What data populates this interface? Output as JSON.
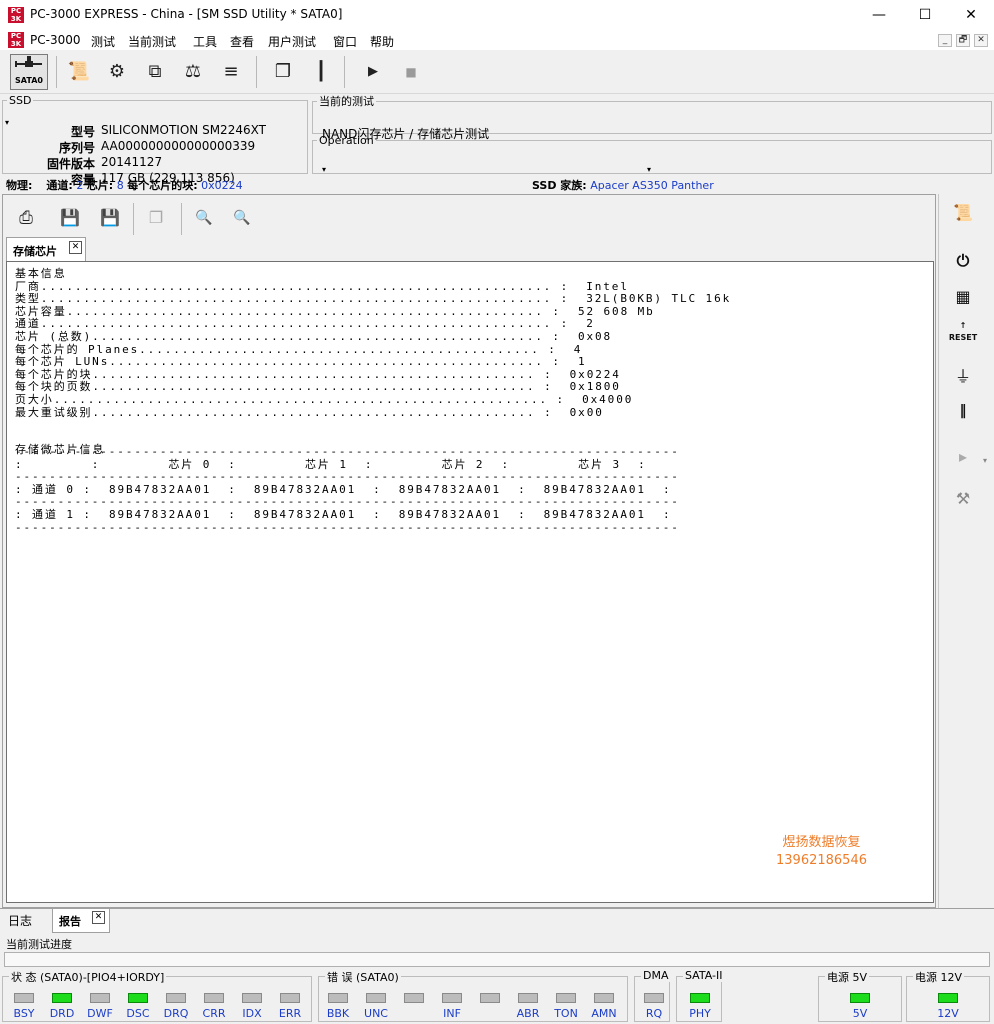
{
  "window": {
    "title": "PC-3000 EXPRESS - China - [SM SSD Utility * SATA0]",
    "controls": [
      "—",
      "☐",
      "✕"
    ]
  },
  "menu": {
    "items": [
      "PC-3000",
      "测试",
      "当前测试",
      "工具",
      "查看",
      "用户测试",
      "窗口",
      "帮助"
    ],
    "mdi": [
      "_",
      "🗗",
      "✕"
    ]
  },
  "toolbar": {
    "sata_label": "SATA0"
  },
  "ssd": {
    "legend": "SSD",
    "fields": [
      {
        "k": "型号",
        "v": "SILICONMOTION SM2246XT"
      },
      {
        "k": "序列号",
        "v": "AA000000000000000339"
      },
      {
        "k": "固件版本",
        "v": "20141127"
      },
      {
        "k": "容量",
        "v": "117 GB (229 113 856)"
      }
    ]
  },
  "current_test": {
    "legend": "当前的测试",
    "value": "NAND闪存芯片 / 存储芯片测试"
  },
  "operation": {
    "legend": "Operation",
    "value": ""
  },
  "phys": {
    "label": "物理:",
    "channels_label": "通道:",
    "channels": "2",
    "chips_label": "芯片:",
    "chips": "8",
    "blocks_label": "每个芯片的块:",
    "blocks": "0x0224",
    "family_label": "SSD 家族:",
    "family": "Apacer AS350 Panther"
  },
  "inner_tab": {
    "label": "存储芯片",
    "close": "✕"
  },
  "report": {
    "section1_title": "基本信息",
    "rows": [
      {
        "label": "厂商",
        "value": "Intel"
      },
      {
        "label": "类型",
        "value": "32L(B0KB) TLC 16k"
      },
      {
        "label": "芯片容量",
        "value": "52 608 Mb"
      },
      {
        "label": "通道",
        "value": "2"
      },
      {
        "label": "芯片 (总数)",
        "value": "0x08"
      },
      {
        "label": "每个芯片的 Planes",
        "value": "4"
      },
      {
        "label": "每个芯片 LUNs",
        "value": "1"
      },
      {
        "label": "每个芯片的块",
        "value": "0x0224"
      },
      {
        "label": "每个块的页数",
        "value": "0x1800"
      },
      {
        "label": "页大小",
        "value": "0x4000"
      },
      {
        "label": "最大重试级别",
        "value": "0x00"
      }
    ],
    "section2_title": "存储微芯片信息",
    "table": {
      "headers": [
        "芯片 0",
        "芯片 1",
        "芯片 2",
        "芯片 3"
      ],
      "rows": [
        {
          "label": "通道 0",
          "cells": [
            "89B47832AA01",
            "89B47832AA01",
            "89B47832AA01",
            "89B47832AA01"
          ]
        },
        {
          "label": "通道 1",
          "cells": [
            "89B47832AA01",
            "89B47832AA01",
            "89B47832AA01",
            "89B47832AA01"
          ]
        }
      ]
    }
  },
  "watermark": {
    "line1": "煜扬数据恢复",
    "line2": "13962186546"
  },
  "bottom_tabs": [
    {
      "label": "日志",
      "active": false
    },
    {
      "label": "报告",
      "active": true
    }
  ],
  "progress": {
    "label": "当前测试进度",
    "fraction": 0
  },
  "status_groups": [
    {
      "title": "状 态 (SATA0)-[PIO4+IORDY]",
      "items": [
        {
          "label": "BSY",
          "on": false
        },
        {
          "label": "DRD",
          "on": true
        },
        {
          "label": "DWF",
          "on": false
        },
        {
          "label": "DSC",
          "on": true
        },
        {
          "label": "DRQ",
          "on": false
        },
        {
          "label": "CRR",
          "on": false
        },
        {
          "label": "IDX",
          "on": false
        },
        {
          "label": "ERR",
          "on": false
        }
      ]
    },
    {
      "title": "错 误 (SATA0)",
      "items": [
        {
          "label": "BBK",
          "on": false
        },
        {
          "label": "UNC",
          "on": false
        },
        {
          "label": "",
          "on": false
        },
        {
          "label": "INF",
          "on": false
        },
        {
          "label": "",
          "on": false
        },
        {
          "label": "ABR",
          "on": false
        },
        {
          "label": "TON",
          "on": false
        },
        {
          "label": "AMN",
          "on": false
        }
      ]
    },
    {
      "title": "DMA",
      "items": [
        {
          "label": "RQ",
          "on": false
        }
      ]
    },
    {
      "title": "SATA-II",
      "items": [
        {
          "label": "PHY",
          "on": true
        }
      ]
    },
    {
      "title": "电源 5V",
      "items": [
        {
          "label": "5V",
          "on": true
        }
      ]
    },
    {
      "title": "电源 12V",
      "items": [
        {
          "label": "12V",
          "on": true
        }
      ]
    }
  ],
  "colors": {
    "led_on": "#1cdc1c",
    "led_off": "#bcbcbc",
    "link_blue": "#1a3cc8",
    "watermark": "#ee7d2a",
    "brand_red": "#c8102e"
  }
}
